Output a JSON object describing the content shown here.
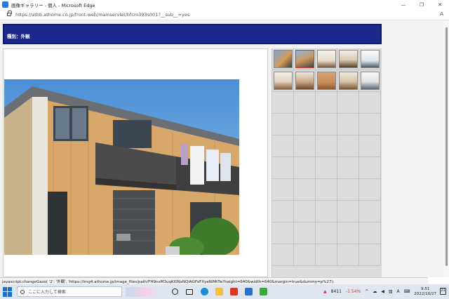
{
  "window": {
    "title": "画像ギャラリー - 個人 - Microsoft Edge",
    "minimize": "—",
    "maximize": "❐",
    "close": "✕"
  },
  "address": {
    "url": "https://atbb.athome.co.jp/front-web/mainservlet/bfcm393s001?__sub__=yes"
  },
  "page": {
    "category_label": "種別：外観",
    "thumbnails_count": 10
  },
  "status": {
    "text": "javascript:changeGazo(                '2',      '外観',   'https://img4.athome.jp/image_files/path/FH9nxM3uqKl0NxNQiAGFoFXyeNlMtTw?height=640&width=640&margin=true&dummy=p%27);"
  },
  "taskbar": {
    "search_placeholder": "ここに入力して検索",
    "stock_value": "8411",
    "stock_change": "-1.54%",
    "ime": "A",
    "time": "9:51",
    "date": "2022/10/27",
    "notifications": "21"
  }
}
